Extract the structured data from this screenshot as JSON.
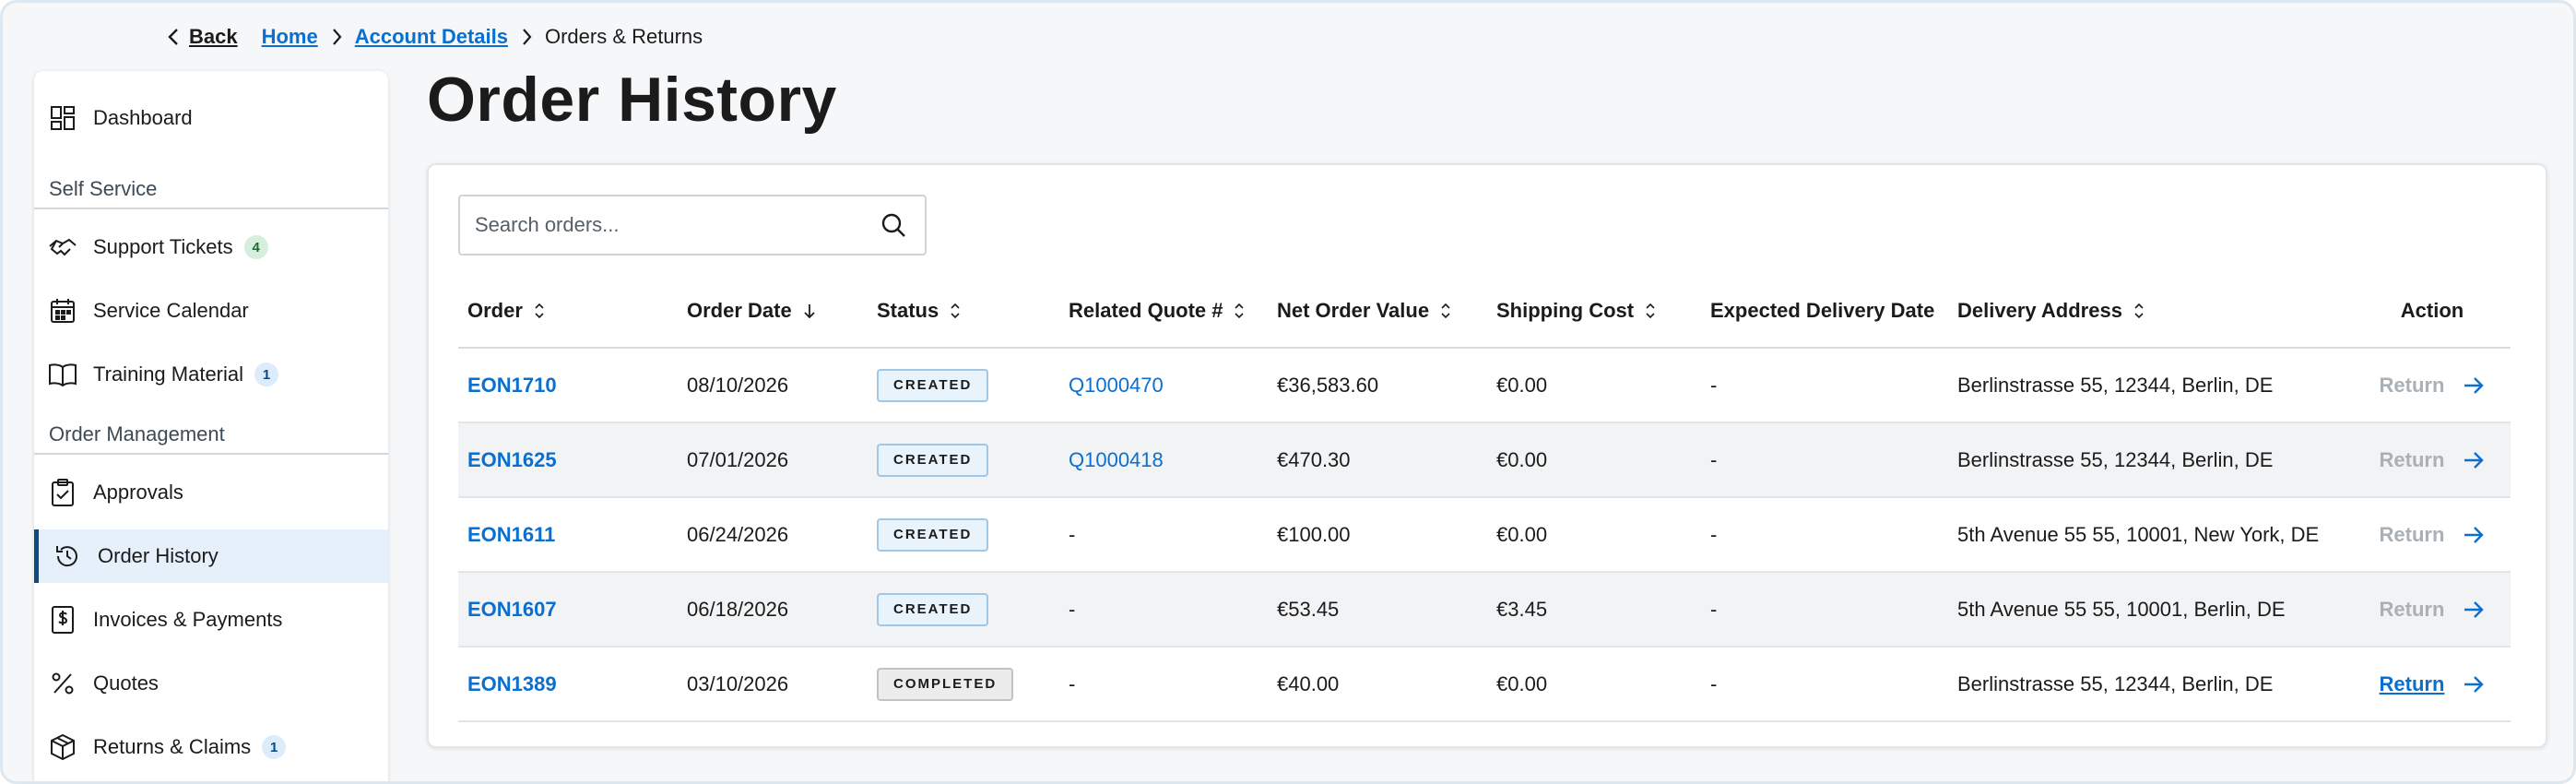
{
  "breadcrumb": {
    "back_label": "Back",
    "items": [
      "Home",
      "Account Details"
    ],
    "current": "Orders & Returns"
  },
  "sidebar": {
    "dashboard": "Dashboard",
    "section_self_service": "Self Service",
    "support_tickets": "Support Tickets",
    "support_tickets_count": "4",
    "service_calendar": "Service Calendar",
    "training_material": "Training Material",
    "training_material_count": "1",
    "section_order_management": "Order Management",
    "approvals": "Approvals",
    "order_history": "Order History",
    "invoices_payments": "Invoices & Payments",
    "quotes": "Quotes",
    "returns_claims": "Returns & Claims",
    "returns_claims_count": "1"
  },
  "main": {
    "title": "Order History",
    "search_placeholder": "Search orders...",
    "columns": {
      "order": "Order",
      "order_date": "Order Date",
      "status": "Status",
      "related_quote": "Related Quote #",
      "net_order_value": "Net Order Value",
      "shipping_cost": "Shipping Cost",
      "expected_delivery": "Expected Delivery Date",
      "delivery_address": "Delivery Address",
      "action": "Action"
    },
    "rows": [
      {
        "order": "EON1710",
        "date": "08/10/2026",
        "status": "CREATED",
        "quote": "Q1000470",
        "net": "€36,583.60",
        "shipping": "€0.00",
        "expected": "-",
        "address": "Berlinstrasse 55, 12344, Berlin, DE",
        "action": "Return"
      },
      {
        "order": "EON1625",
        "date": "07/01/2026",
        "status": "CREATED",
        "quote": "Q1000418",
        "net": "€470.30",
        "shipping": "€0.00",
        "expected": "-",
        "address": "Berlinstrasse 55, 12344, Berlin, DE",
        "action": "Return"
      },
      {
        "order": "EON1611",
        "date": "06/24/2026",
        "status": "CREATED",
        "quote": "-",
        "net": "€100.00",
        "shipping": "€0.00",
        "expected": "-",
        "address": "5th Avenue 55 55, 10001, New York, DE",
        "action": "Return"
      },
      {
        "order": "EON1607",
        "date": "06/18/2026",
        "status": "CREATED",
        "quote": "-",
        "net": "€53.45",
        "shipping": "€3.45",
        "expected": "-",
        "address": "5th Avenue 55 55, 10001, Berlin, DE",
        "action": "Return"
      },
      {
        "order": "EON1389",
        "date": "03/10/2026",
        "status": "COMPLETED",
        "quote": "-",
        "net": "€40.00",
        "shipping": "€0.00",
        "expected": "-",
        "address": "Berlinstrasse 55, 12344, Berlin, DE",
        "action": "Return"
      }
    ]
  },
  "colors": {
    "link": "#0b6fcf",
    "active_nav_bg": "#e6f0fa",
    "active_nav_bar": "#0c4a80",
    "created_badge_bg": "#e8f3fc",
    "completed_badge_bg": "#ececec"
  }
}
